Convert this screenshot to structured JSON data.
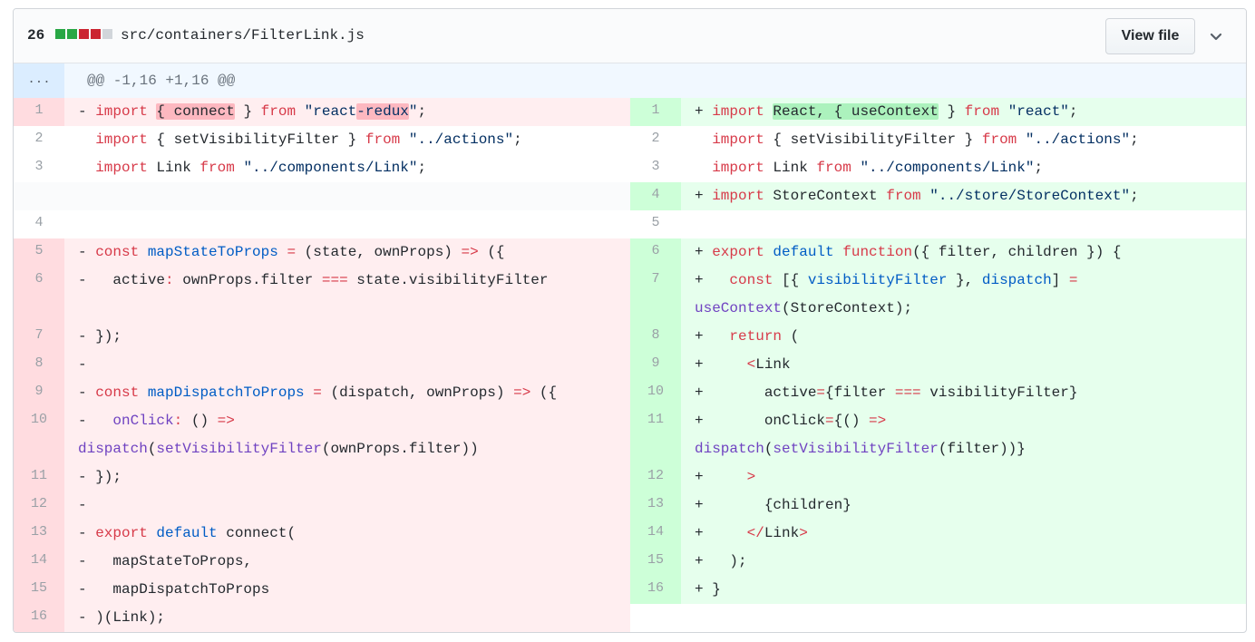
{
  "header": {
    "changes_count": "26",
    "diffstat": [
      "#28a745",
      "#28a745",
      "#cb2431",
      "#cb2431",
      "#d1d5da"
    ],
    "file_path": "src/containers/FilterLink.js",
    "view_file_label": "View file",
    "collapse_icon": "chevron-down-icon"
  },
  "hunk": {
    "expand_label": "...",
    "header": "@@ -1,16 +1,16 @@"
  },
  "left": [
    {
      "n": "1",
      "type": "del",
      "rows": 1,
      "segs": [
        {
          "t": "- "
        },
        {
          "t": "import",
          "c": "kw"
        },
        {
          "t": " "
        },
        {
          "t": "{ connect",
          "c": "hl-del"
        },
        {
          "t": " } "
        },
        {
          "t": "from",
          "c": "kw"
        },
        {
          "t": " "
        },
        {
          "t": "\"react",
          "c": "str"
        },
        {
          "t": "-redux",
          "c": "str hl-del"
        },
        {
          "t": "\"",
          "c": "str"
        },
        {
          "t": ";"
        }
      ]
    },
    {
      "n": "2",
      "type": "ctx",
      "rows": 1,
      "segs": [
        {
          "t": "  "
        },
        {
          "t": "import",
          "c": "kw"
        },
        {
          "t": " { setVisibilityFilter } "
        },
        {
          "t": "from",
          "c": "kw"
        },
        {
          "t": " "
        },
        {
          "t": "\"../actions\"",
          "c": "str"
        },
        {
          "t": ";"
        }
      ]
    },
    {
      "n": "3",
      "type": "ctx",
      "rows": 1,
      "segs": [
        {
          "t": "  "
        },
        {
          "t": "import",
          "c": "kw"
        },
        {
          "t": " Link "
        },
        {
          "t": "from",
          "c": "kw"
        },
        {
          "t": " "
        },
        {
          "t": "\"../components/Link\"",
          "c": "str"
        },
        {
          "t": ";"
        }
      ]
    },
    {
      "n": "",
      "type": "empty",
      "rows": 1,
      "segs": []
    },
    {
      "n": "4",
      "type": "ctx",
      "rows": 1,
      "segs": []
    },
    {
      "n": "5",
      "type": "del",
      "rows": 1,
      "segs": [
        {
          "t": "- "
        },
        {
          "t": "const",
          "c": "kw"
        },
        {
          "t": " "
        },
        {
          "t": "mapStateToProps",
          "c": "cst"
        },
        {
          "t": " "
        },
        {
          "t": "=",
          "c": "kw"
        },
        {
          "t": " (state, ownProps) "
        },
        {
          "t": "=>",
          "c": "kw"
        },
        {
          "t": " ({"
        }
      ]
    },
    {
      "n": "6",
      "type": "del",
      "rows": 2,
      "segs": [
        {
          "t": "-   active"
        },
        {
          "t": ":",
          "c": "kw"
        },
        {
          "t": " ownProps.filter "
        },
        {
          "t": "===",
          "c": "kw"
        },
        {
          "t": " state.visibilityFilter"
        }
      ]
    },
    {
      "n": "7",
      "type": "del",
      "rows": 1,
      "segs": [
        {
          "t": "- });"
        }
      ]
    },
    {
      "n": "8",
      "type": "del",
      "rows": 1,
      "segs": [
        {
          "t": "-"
        }
      ]
    },
    {
      "n": "9",
      "type": "del",
      "rows": 1,
      "segs": [
        {
          "t": "- "
        },
        {
          "t": "const",
          "c": "kw"
        },
        {
          "t": " "
        },
        {
          "t": "mapDispatchToProps",
          "c": "cst"
        },
        {
          "t": " "
        },
        {
          "t": "=",
          "c": "kw"
        },
        {
          "t": " (dispatch, ownProps) "
        },
        {
          "t": "=>",
          "c": "kw"
        },
        {
          "t": " ({"
        }
      ]
    },
    {
      "n": "10",
      "type": "del",
      "rows": 2,
      "segs": [
        {
          "t": "-   "
        },
        {
          "t": "onClick",
          "c": "fn"
        },
        {
          "t": ":",
          "c": "kw"
        },
        {
          "t": " () "
        },
        {
          "t": "=>",
          "c": "kw"
        },
        {
          "t": "\n"
        },
        {
          "t": "dispatch",
          "c": "fn"
        },
        {
          "t": "("
        },
        {
          "t": "setVisibilityFilter",
          "c": "fn"
        },
        {
          "t": "(ownProps.filter))"
        }
      ]
    },
    {
      "n": "11",
      "type": "del",
      "rows": 1,
      "segs": [
        {
          "t": "- });"
        }
      ]
    },
    {
      "n": "12",
      "type": "del",
      "rows": 1,
      "segs": [
        {
          "t": "-"
        }
      ]
    },
    {
      "n": "13",
      "type": "del",
      "rows": 1,
      "segs": [
        {
          "t": "- "
        },
        {
          "t": "export",
          "c": "kw"
        },
        {
          "t": " "
        },
        {
          "t": "default",
          "c": "cst"
        },
        {
          "t": " connect("
        }
      ]
    },
    {
      "n": "14",
      "type": "del",
      "rows": 1,
      "segs": [
        {
          "t": "-   mapStateToProps,"
        }
      ]
    },
    {
      "n": "15",
      "type": "del",
      "rows": 1,
      "segs": [
        {
          "t": "-   mapDispatchToProps"
        }
      ]
    },
    {
      "n": "16",
      "type": "del",
      "rows": 1,
      "segs": [
        {
          "t": "- )(Link);"
        }
      ]
    }
  ],
  "right": [
    {
      "n": "1",
      "type": "add",
      "rows": 1,
      "segs": [
        {
          "t": "+ "
        },
        {
          "t": "import",
          "c": "kw"
        },
        {
          "t": " "
        },
        {
          "t": "React, { useContext",
          "c": "hl-add"
        },
        {
          "t": " } "
        },
        {
          "t": "from",
          "c": "kw"
        },
        {
          "t": " "
        },
        {
          "t": "\"react\"",
          "c": "str"
        },
        {
          "t": ";"
        }
      ]
    },
    {
      "n": "2",
      "type": "ctx",
      "rows": 1,
      "segs": [
        {
          "t": "  "
        },
        {
          "t": "import",
          "c": "kw"
        },
        {
          "t": " { setVisibilityFilter } "
        },
        {
          "t": "from",
          "c": "kw"
        },
        {
          "t": " "
        },
        {
          "t": "\"../actions\"",
          "c": "str"
        },
        {
          "t": ";"
        }
      ]
    },
    {
      "n": "3",
      "type": "ctx",
      "rows": 1,
      "segs": [
        {
          "t": "  "
        },
        {
          "t": "import",
          "c": "kw"
        },
        {
          "t": " Link "
        },
        {
          "t": "from",
          "c": "kw"
        },
        {
          "t": " "
        },
        {
          "t": "\"../components/Link\"",
          "c": "str"
        },
        {
          "t": ";"
        }
      ]
    },
    {
      "n": "4",
      "type": "add",
      "rows": 1,
      "segs": [
        {
          "t": "+ "
        },
        {
          "t": "import",
          "c": "kw"
        },
        {
          "t": " StoreContext "
        },
        {
          "t": "from",
          "c": "kw"
        },
        {
          "t": " "
        },
        {
          "t": "\"../store/StoreContext\"",
          "c": "str"
        },
        {
          "t": ";"
        }
      ]
    },
    {
      "n": "5",
      "type": "ctx",
      "rows": 1,
      "segs": []
    },
    {
      "n": "6",
      "type": "add",
      "rows": 1,
      "segs": [
        {
          "t": "+ "
        },
        {
          "t": "export",
          "c": "kw"
        },
        {
          "t": " "
        },
        {
          "t": "default",
          "c": "cst"
        },
        {
          "t": " "
        },
        {
          "t": "function",
          "c": "kw"
        },
        {
          "t": "({ filter, children }) {"
        }
      ]
    },
    {
      "n": "7",
      "type": "add",
      "rows": 2,
      "segs": [
        {
          "t": "+   "
        },
        {
          "t": "const",
          "c": "kw"
        },
        {
          "t": " [{ "
        },
        {
          "t": "visibilityFilter",
          "c": "cst"
        },
        {
          "t": " }, "
        },
        {
          "t": "dispatch",
          "c": "cst"
        },
        {
          "t": "] "
        },
        {
          "t": "=",
          "c": "kw"
        },
        {
          "t": "\n"
        },
        {
          "t": "useContext",
          "c": "fn"
        },
        {
          "t": "(StoreContext);"
        }
      ]
    },
    {
      "n": "8",
      "type": "add",
      "rows": 1,
      "segs": [
        {
          "t": "+   "
        },
        {
          "t": "return",
          "c": "kw"
        },
        {
          "t": " ("
        }
      ]
    },
    {
      "n": "9",
      "type": "add",
      "rows": 1,
      "segs": [
        {
          "t": "+     "
        },
        {
          "t": "<",
          "c": "kw"
        },
        {
          "t": "Link"
        }
      ]
    },
    {
      "n": "10",
      "type": "add",
      "rows": 1,
      "segs": [
        {
          "t": "+       active"
        },
        {
          "t": "=",
          "c": "kw"
        },
        {
          "t": "{filter "
        },
        {
          "t": "===",
          "c": "kw"
        },
        {
          "t": " visibilityFilter}"
        }
      ]
    },
    {
      "n": "11",
      "type": "add",
      "rows": 2,
      "segs": [
        {
          "t": "+       onClick"
        },
        {
          "t": "=",
          "c": "kw"
        },
        {
          "t": "{() "
        },
        {
          "t": "=>",
          "c": "kw"
        },
        {
          "t": "\n"
        },
        {
          "t": "dispatch",
          "c": "fn"
        },
        {
          "t": "("
        },
        {
          "t": "setVisibilityFilter",
          "c": "fn"
        },
        {
          "t": "(filter))}"
        }
      ]
    },
    {
      "n": "12",
      "type": "add",
      "rows": 1,
      "segs": [
        {
          "t": "+     "
        },
        {
          "t": ">",
          "c": "kw"
        }
      ]
    },
    {
      "n": "13",
      "type": "add",
      "rows": 1,
      "segs": [
        {
          "t": "+       {children}"
        }
      ]
    },
    {
      "n": "14",
      "type": "add",
      "rows": 1,
      "segs": [
        {
          "t": "+     "
        },
        {
          "t": "</",
          "c": "kw"
        },
        {
          "t": "Link"
        },
        {
          "t": ">",
          "c": "kw"
        }
      ]
    },
    {
      "n": "15",
      "type": "add",
      "rows": 1,
      "segs": [
        {
          "t": "+   );"
        }
      ]
    },
    {
      "n": "16",
      "type": "add",
      "rows": 1,
      "segs": [
        {
          "t": "+ }"
        }
      ]
    }
  ]
}
